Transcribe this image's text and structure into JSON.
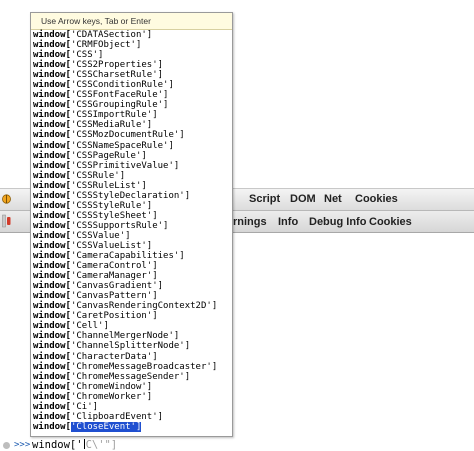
{
  "autocomplete": {
    "hint": "Use Arrow keys, Tab or Enter",
    "prefix": "window[",
    "selected_index": 39,
    "items": [
      "'CDATASection']",
      "'CRMFObject']",
      "'CSS']",
      "'CSS2Properties']",
      "'CSSCharsetRule']",
      "'CSSConditionRule']",
      "'CSSFontFaceRule']",
      "'CSSGroupingRule']",
      "'CSSImportRule']",
      "'CSSMediaRule']",
      "'CSSMozDocumentRule']",
      "'CSSNameSpaceRule']",
      "'CSSPageRule']",
      "'CSSPrimitiveValue']",
      "'CSSRule']",
      "'CSSRuleList']",
      "'CSSStyleDeclaration']",
      "'CSSStyleRule']",
      "'CSSStyleSheet']",
      "'CSSSupportsRule']",
      "'CSSValue']",
      "'CSSValueList']",
      "'CameraCapabilities']",
      "'CameraControl']",
      "'CameraManager']",
      "'CanvasGradient']",
      "'CanvasPattern']",
      "'CanvasRenderingContext2D']",
      "'CaretPosition']",
      "'Cell']",
      "'ChannelMergerNode']",
      "'ChannelSplitterNode']",
      "'CharacterData']",
      "'ChromeMessageBroadcaster']",
      "'ChromeMessageSender']",
      "'ChromeWindow']",
      "'ChromeWorker']",
      "'Ci']",
      "'ClipboardEvent']",
      "'CloseEvent']"
    ]
  },
  "toolbar_main": {
    "tabs": [
      "Script",
      "DOM",
      "Net",
      "Cookies"
    ]
  },
  "toolbar_filters": {
    "tabs": [
      "rnings",
      "Info",
      "Debug Info",
      "Cookies"
    ]
  },
  "command_line": {
    "prompt": ">>>",
    "typed": "window['",
    "ghost": "C\\'\"]"
  },
  "icons": {
    "firebug": "firebug-bug-icon",
    "break": "break-on-error-icon"
  }
}
